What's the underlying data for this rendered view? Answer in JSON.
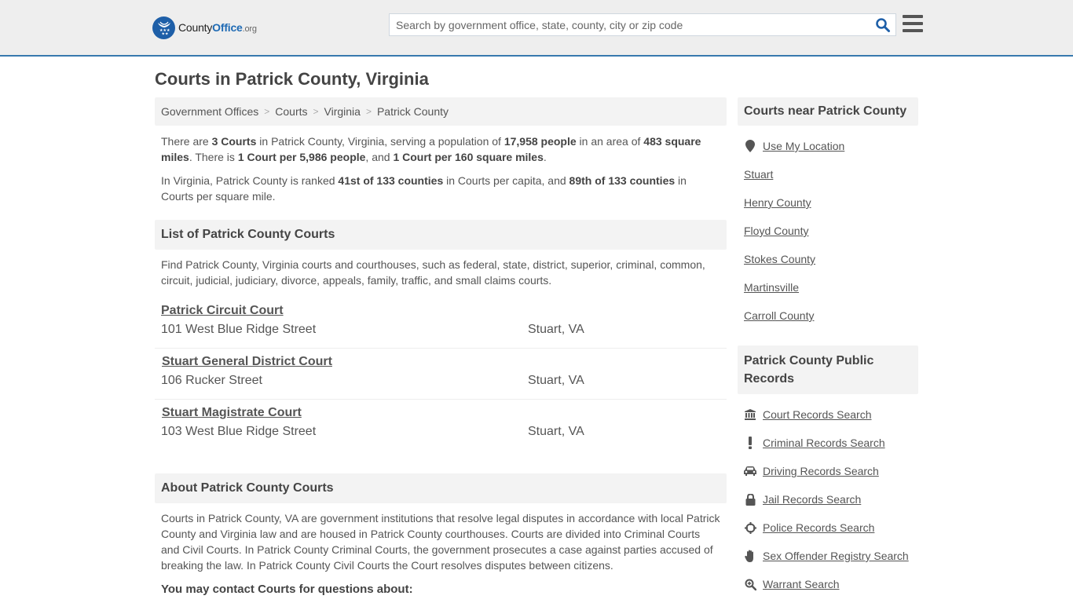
{
  "header": {
    "logo": {
      "part1": "County",
      "part2": "Office",
      "part3": ".org"
    },
    "search": {
      "placeholder": "Search by government office, state, county, city or zip code",
      "value": ""
    },
    "search_icon": "search-icon",
    "menu_icon": "hamburger-menu-icon"
  },
  "page_title": "Courts in Patrick County, Virginia",
  "breadcrumb": [
    {
      "label": "Government Offices"
    },
    {
      "label": "Courts"
    },
    {
      "label": "Virginia"
    },
    {
      "label": "Patrick County"
    }
  ],
  "breadcrumb_separator": ">",
  "intro": {
    "p1": {
      "t1": "There are ",
      "b1": "3 Courts",
      "t2": " in Patrick County, Virginia, serving a population of ",
      "b2": "17,958 people",
      "t3": " in an area of ",
      "b3": "483 square miles",
      "t4": ". There is ",
      "b4": "1 Court per 5,986 people",
      "t5": ", and ",
      "b5": "1 Court per 160 square miles",
      "t6": "."
    },
    "p2": {
      "t1": "In Virginia, Patrick County is ranked ",
      "b1": "41st of 133 counties",
      "t2": " in Courts per capita, and ",
      "b2": "89th of 133 counties",
      "t3": " in Courts per square mile."
    }
  },
  "list_section": {
    "heading": "List of Patrick County Courts",
    "description": "Find Patrick County, Virginia courts and courthouses, such as federal, state, district, superior, criminal, common, circuit, judicial, judiciary, divorce, appeals, family, traffic, and small claims courts.",
    "courts": [
      {
        "name": "Patrick Circuit Court",
        "address": "101 West Blue Ridge Street",
        "city": "Stuart, VA"
      },
      {
        "name": "Stuart General District Court",
        "address": "106 Rucker Street",
        "city": "Stuart, VA"
      },
      {
        "name": "Stuart Magistrate Court",
        "address": "103 West Blue Ridge Street",
        "city": "Stuart, VA"
      }
    ]
  },
  "about_section": {
    "heading": "About Patrick County Courts",
    "body": "Courts in Patrick County, VA are government institutions that resolve legal disputes in accordance with local Patrick County and Virginia law and are housed in Patrick County courthouses. Courts are divided into Criminal Courts and Civil Courts. In Patrick County Criminal Courts, the government prosecutes a case against parties accused of breaking the law. In Patrick County Civil Courts the Court resolves disputes between citizens.",
    "contact_heading": "You may contact Courts for questions about:"
  },
  "sidebar": {
    "nearby": {
      "heading": "Courts near Patrick County",
      "use_location": {
        "label": "Use My Location",
        "icon": "map-marker-icon"
      },
      "links": [
        "Stuart",
        "Henry County",
        "Floyd County",
        "Stokes County",
        "Martinsville",
        "Carroll County"
      ]
    },
    "public_records": {
      "heading": "Patrick County Public Records",
      "links": [
        {
          "label": "Court Records Search",
          "icon": "courthouse-icon"
        },
        {
          "label": "Criminal Records Search",
          "icon": "exclamation-icon"
        },
        {
          "label": "Driving Records Search",
          "icon": "car-icon"
        },
        {
          "label": "Jail Records Search",
          "icon": "lock-icon"
        },
        {
          "label": "Police Records Search",
          "icon": "crosshairs-icon"
        },
        {
          "label": "Sex Offender Registry Search",
          "icon": "hand-icon"
        },
        {
          "label": "Warrant Search",
          "icon": "zoom-in-icon"
        }
      ]
    }
  },
  "colors": {
    "brand_blue": "#1e6ab4",
    "header_border": "#3779ae",
    "header_bg": "#eeeeee",
    "panel_bg": "#f3f3f3",
    "text": "#555555"
  }
}
